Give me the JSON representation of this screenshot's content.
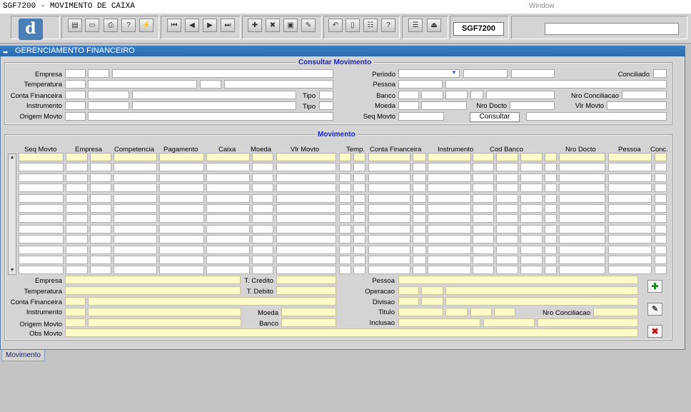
{
  "app": {
    "title": "SGF7200 - MOVIMENTO DE CAIXA",
    "menu_window": "Window",
    "form_code": "SGF7200"
  },
  "window": {
    "title": "GERENCIAMENTO FINANCEIRO"
  },
  "consulta": {
    "title": "Consultar Movimento",
    "empresa": "Empresa",
    "temperatura": "Temperatura",
    "conta_financeira": "Conta Financeira",
    "instrumento": "Instrumento",
    "origem_movto": "Origem Movto",
    "tipo1": "Tipo",
    "tipo2": "Tipo",
    "periodo": "Periodo",
    "pessoa": "Pessoa",
    "banco": "Banco",
    "moeda": "Moeda",
    "seq_movto": "Seq Movto",
    "conciliado": "Conciliado",
    "nro_conciliacao": "Nro Conciliacao",
    "nro_docto": "Nro Docto",
    "vlr_movto": "Vlr Movto",
    "consultar_button": "Consultar"
  },
  "movimento": {
    "title": "Movimento",
    "columns": [
      "Seq Movto",
      "Empresa",
      "Competencia",
      "Pagamento",
      "Caixa",
      "Moeda",
      "Vlr Movto",
      "Temp.",
      "Conta Financeira",
      "Instrumento",
      "Cod Banco",
      "Nro Docto",
      "Pessoa",
      "Conc."
    ]
  },
  "detail": {
    "empresa": "Empresa",
    "temperatura": "Temperatura",
    "conta_financeira": "Conta Financeira",
    "instrumento": "Instrumento",
    "origem_movto": "Origem Movto",
    "obs_movto": "Obs Movto",
    "t_credito": "T. Credito",
    "t_debito": "T. Debito",
    "moeda": "Moeda",
    "banco": "Banco",
    "pessoa": "Pessoa",
    "operacao": "Operacao",
    "divisao": "Divisao",
    "titulo": "Titulo",
    "inclusao": "Inclusao",
    "nro_conciliacao": "Nro Conciliacao"
  },
  "tabs": {
    "movimento": "Movimento"
  },
  "toolbar": {
    "icons": [
      "save-icon",
      "window-icon",
      "print-icon",
      "query-icon",
      "execute-query-icon",
      "first-record-icon",
      "previous-record-icon",
      "next-record-icon",
      "last-record-icon",
      "insert-record-icon",
      "delete-record-icon",
      "filter-icon",
      "edit-icon",
      "undo-icon",
      "clipboard-icon",
      "options-icon",
      "help-icon",
      "menu-icon",
      "exit-icon"
    ],
    "glyphs": [
      "▤",
      "▭",
      "⎙",
      "?",
      "⚡",
      "⏮",
      "◀",
      "▶",
      "⏭",
      "✚",
      "✖",
      "▣",
      "✎",
      "↶",
      "▯",
      "☷",
      "?",
      "☰",
      "⏏"
    ]
  },
  "colors": {
    "accent": "#2a6aae",
    "frame_title": "#1a27b5",
    "field_yellow": "#fdfbc8"
  }
}
